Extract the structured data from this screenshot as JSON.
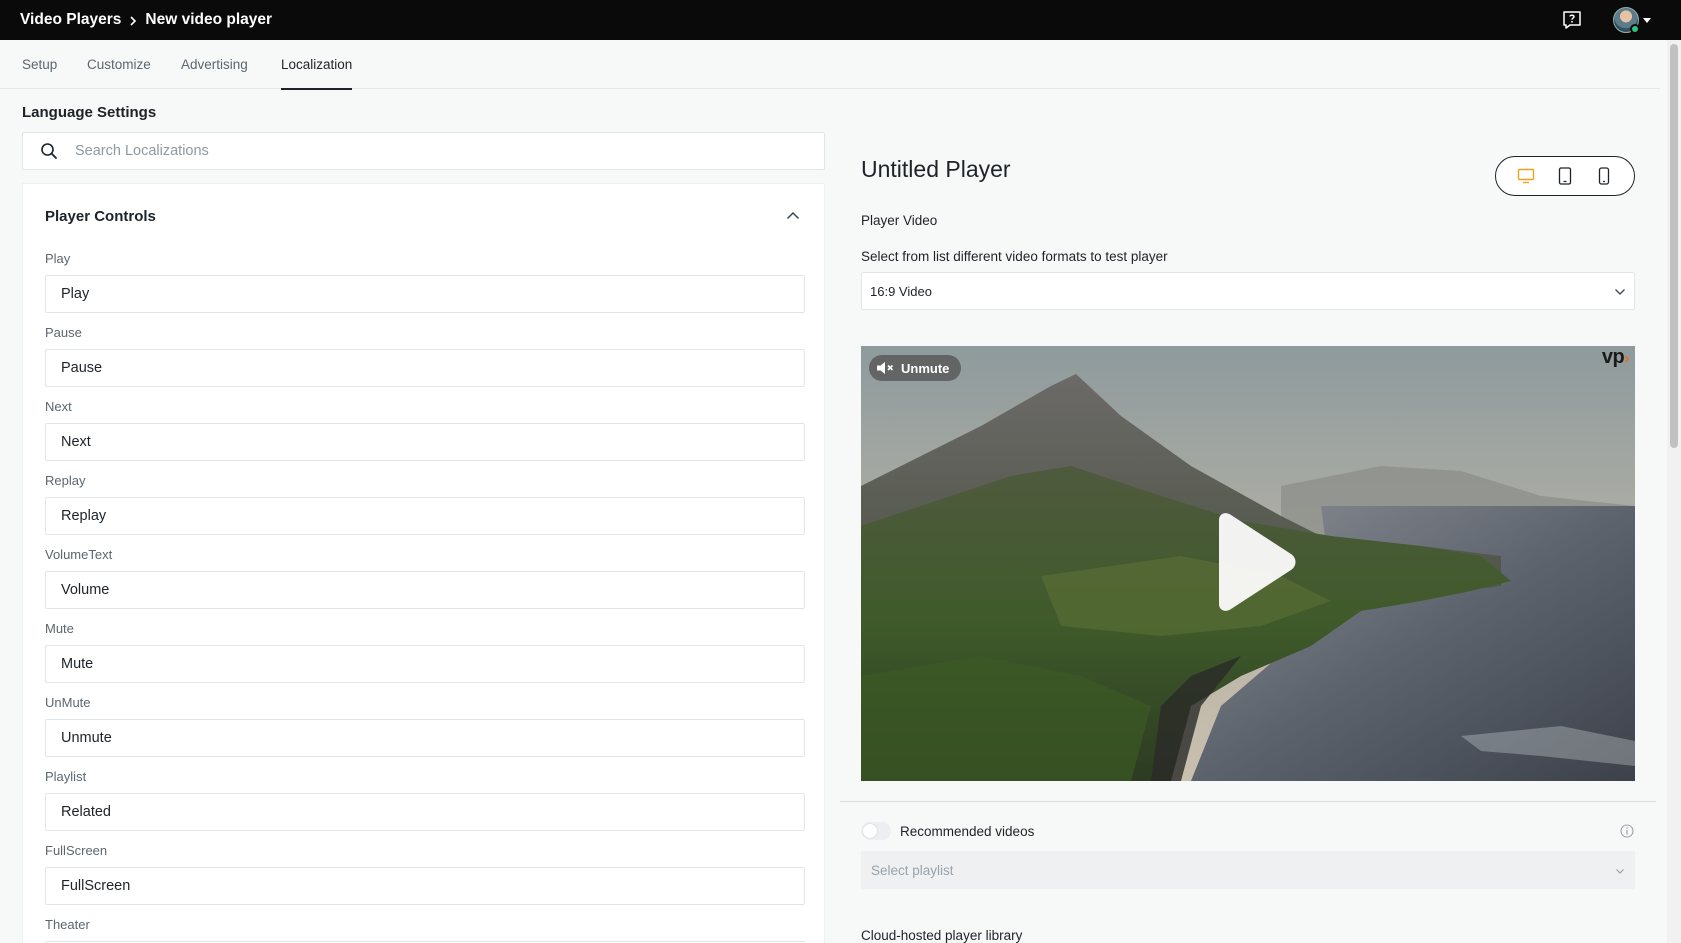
{
  "header": {
    "breadcrumb": [
      "Video Players",
      "New video player"
    ]
  },
  "tabs": [
    {
      "label": "Setup",
      "active": false
    },
    {
      "label": "Customize",
      "active": false
    },
    {
      "label": "Advertising",
      "active": false
    },
    {
      "label": "Localization",
      "active": true
    }
  ],
  "language": {
    "title": "Language Settings",
    "search_placeholder": "Search Localizations",
    "search_value": ""
  },
  "player_controls": {
    "title": "Player Controls",
    "fields": [
      {
        "label": "Play",
        "value": "Play"
      },
      {
        "label": "Pause",
        "value": "Pause"
      },
      {
        "label": "Next",
        "value": "Next"
      },
      {
        "label": "Replay",
        "value": "Replay"
      },
      {
        "label": "VolumeText",
        "value": "Volume"
      },
      {
        "label": "Mute",
        "value": "Mute"
      },
      {
        "label": "UnMute",
        "value": "Unmute"
      },
      {
        "label": "Playlist",
        "value": "Related"
      },
      {
        "label": "FullScreen",
        "value": "FullScreen"
      },
      {
        "label": "Theater",
        "value": ""
      }
    ]
  },
  "preview": {
    "player_title": "Untitled Player",
    "player_video_label": "Player Video",
    "format_help": "Select from list different video formats to test player",
    "format_selected": "16:9 Video",
    "unmute_label": "Unmute",
    "logo_text": "vp",
    "recommended_label": "Recommended videos",
    "recommended_enabled": false,
    "playlist_placeholder": "Select playlist",
    "cloud_label": "Cloud-hosted player library",
    "active_device": "desktop"
  },
  "colors": {
    "topbar": "#0a0a0a",
    "accent_orange": "#f0a020",
    "text": "#1d2329",
    "muted_text": "#5b6770"
  }
}
